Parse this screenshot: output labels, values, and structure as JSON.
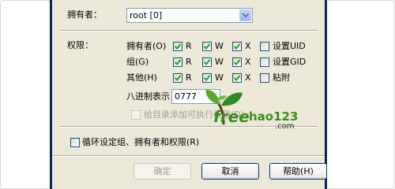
{
  "owner": {
    "label": "拥有者：",
    "value": "root [0]"
  },
  "permissions": {
    "label": "权限：",
    "rows": [
      {
        "name": "拥有者(O)",
        "r": "R",
        "w": "W",
        "x": "X",
        "extra": "设置UID",
        "r_checked": true,
        "w_checked": true,
        "x_checked": true,
        "extra_checked": false
      },
      {
        "name": "组(G)",
        "r": "R",
        "w": "W",
        "x": "X",
        "extra": "设置GID",
        "r_checked": true,
        "w_checked": true,
        "x_checked": true,
        "extra_checked": false
      },
      {
        "name": "其他(H)",
        "r": "R",
        "w": "W",
        "x": "X",
        "extra": "粘附",
        "r_checked": true,
        "w_checked": true,
        "x_checked": true,
        "extra_checked": false
      }
    ],
    "octal_label": "八进制表示",
    "octal_value": "0777",
    "dir_exec_label": "给目录添加可执行权限(D)",
    "dir_exec_checked": false
  },
  "recursive": {
    "label": "循环设定组、拥有者和权限(R)",
    "checked": false
  },
  "buttons": {
    "ok": "确定",
    "cancel": "取消",
    "help": "帮助(H)"
  },
  "watermark": {
    "brand": "free",
    "brand2": "hao123",
    "suffix": ".com"
  },
  "colors": {
    "check": "#21a121",
    "dialog_bg": "#ece9d8",
    "window_border": "#0a246a",
    "brand_green": "#3c8c1e"
  }
}
